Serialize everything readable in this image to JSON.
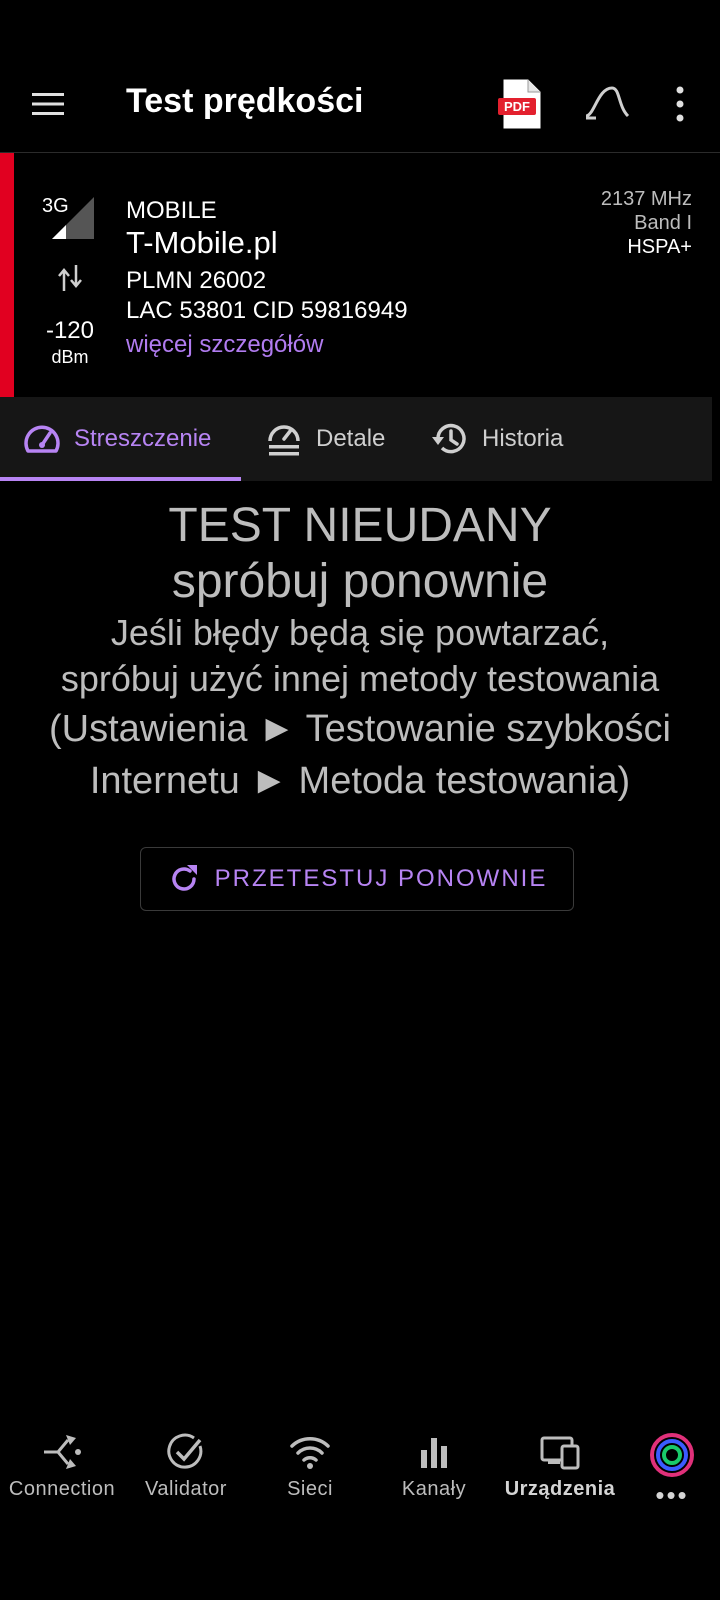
{
  "appbar": {
    "title": "Test prędkości",
    "pdf_label": "PDF"
  },
  "cell": {
    "network_type": "3G",
    "signal_value": "-120",
    "signal_unit": "dBm",
    "connection": "MOBILE",
    "operator": "T-Mobile.pl",
    "plmn": "PLMN 26002",
    "lac_cid": "LAC 53801 CID 59816949",
    "details_link": "więcej szczegółów",
    "frequency": "2137 MHz",
    "band": "Band I",
    "technology": "HSPA+",
    "colors": {
      "indicator": "#e10020",
      "link": "#b17cf0"
    }
  },
  "tabs": [
    {
      "label": "Streszczenie",
      "icon": "speedometer-icon",
      "active": true
    },
    {
      "label": "Detale",
      "icon": "speedometer-list-icon",
      "active": false
    },
    {
      "label": "Historia",
      "icon": "history-icon",
      "active": false
    }
  ],
  "message": {
    "line1": "TEST NIEUDANY",
    "line2": "spróbuj ponownie",
    "line3": "Jeśli błędy będą się powtarzać,",
    "line4": "spróbuj użyć innej metody testowania",
    "line5": "(Ustawienia ► Testowanie szybkości",
    "line6": "Internetu ► Metoda testowania)"
  },
  "retry_button": {
    "label": "PRZETESTUJ PONOWNIE",
    "icon": "refresh-icon"
  },
  "bottom_nav": [
    {
      "label": "Connection",
      "icon": "connection-icon",
      "active": false
    },
    {
      "label": "Validator",
      "icon": "check-circle-icon",
      "active": false
    },
    {
      "label": "Sieci",
      "icon": "wifi-icon",
      "active": false
    },
    {
      "label": "Kanały",
      "icon": "bar-chart-icon",
      "active": false
    },
    {
      "label": "Urządzenia",
      "icon": "devices-icon",
      "active": true
    },
    {
      "label": "•••",
      "icon": "more-horizontal-icon",
      "active": false
    }
  ],
  "accent_color": "#b784f3"
}
